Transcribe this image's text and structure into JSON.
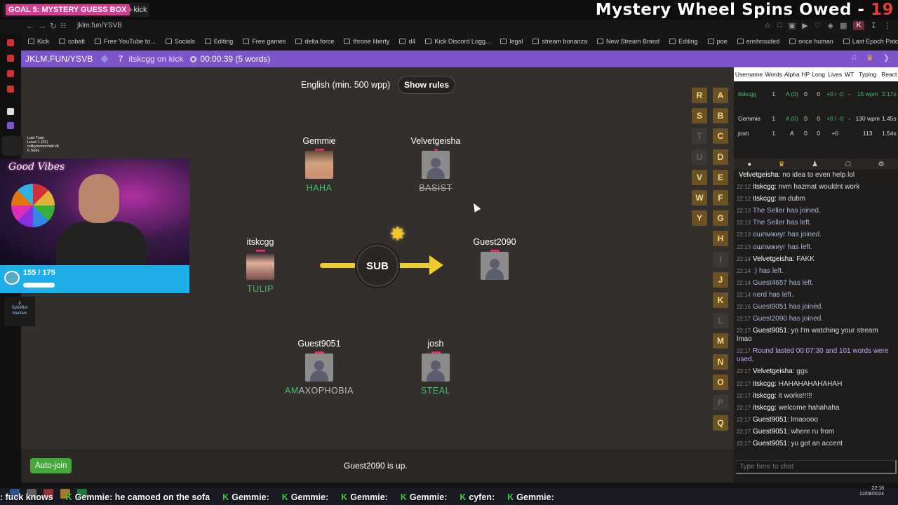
{
  "browser": {
    "tab_goal": "GOAL 5: MYSTERY GUESS BOX",
    "tab_kick": "kick",
    "url": "jklm.fun/YSVB",
    "overlay_title": "Mystery Wheel Spins Owed - ",
    "overlay_count": "19",
    "k_badge": "K"
  },
  "bookmarks": [
    "Kick",
    "cobalt",
    "Free YouTube to...",
    "Socials",
    "Editing",
    "Free games",
    "delta force",
    "throne liberty",
    "d4",
    "Kick Discord Logg...",
    "legal",
    "stream bonanza",
    "New Stream Brand",
    "Editing",
    "poe",
    "enshrouded",
    "once human",
    "Last Epoch Patch..."
  ],
  "header": {
    "room": "JKLM.FUN/YSVB",
    "player_count": "7",
    "host": "itskcgg on kick",
    "timer": "00:00:39 (5 words)"
  },
  "game": {
    "rules_text": "English (min. 500 wpp)",
    "show_rules": "Show rules",
    "prompt": "SUB",
    "status": "Guest2090 is up.",
    "auto_join": "Auto-join",
    "players": [
      {
        "name": "Gemmie",
        "hearts": "♥♥♥",
        "word": "HAHA",
        "style": "green"
      },
      {
        "name": "Velvetgeisha",
        "hearts": "♥",
        "word": "BASIST",
        "style": "strike"
      },
      {
        "name": "itskcgg",
        "hearts": "♥♥♥",
        "word": "TULIP",
        "style": "green"
      },
      {
        "name": "Guest2090",
        "hearts": "♥♥♥",
        "word": "",
        "style": "grey"
      },
      {
        "name": "Guest9051",
        "hearts": "♥♥♥",
        "word_hi": "AM",
        "word_rest": "AXOPHOBIA",
        "style": "mixed"
      },
      {
        "name": "josh",
        "hearts": "♥♥♥",
        "word": "STEAL",
        "style": "green"
      }
    ],
    "letters_left": [
      "R",
      "S",
      "T",
      "U",
      "V",
      "W",
      "Y"
    ],
    "letters_right": [
      "A",
      "B",
      "C",
      "D",
      "E",
      "F",
      "G",
      "H",
      "I",
      "J",
      "K",
      "L",
      "M",
      "N",
      "O",
      "P",
      "Q"
    ]
  },
  "scoreboard": {
    "headers": [
      "Username",
      "Words",
      "Alpha",
      "HP",
      "Long",
      "Lives",
      "WT",
      "Typing",
      "React"
    ],
    "rows": [
      {
        "user": "itskcgg",
        "words": "1",
        "alpha": "A (0)",
        "hp": "0",
        "long": "0",
        "lives": "+0 / -0",
        "wt": "-",
        "typing": "15 wpm",
        "react": "2.17s",
        "green": true
      },
      {
        "user": "Gemmie",
        "words": "1",
        "alpha": "A (0)",
        "hp": "0",
        "long": "0",
        "lives": "+0 / -0",
        "wt": "-",
        "typing": "130 wpm",
        "react": "1.45s",
        "green": false
      },
      {
        "user": "josh",
        "words": "1",
        "alpha": "A",
        "hp": "0",
        "long": "0",
        "lives": "+0",
        "wt": "",
        "typing": "113",
        "react": "1.54s",
        "green": false
      }
    ]
  },
  "chat": {
    "input_placeholder": "Type here to chat",
    "messages": [
      {
        "time": "",
        "user": "Velvetgeisha:",
        "text": " no idea to even help lol"
      },
      {
        "time": "22:12",
        "user": "itskcgg:",
        "text": " nvm hazmat wouldnt work"
      },
      {
        "time": "22:12",
        "user": "itskcgg:",
        "text": " im dubm"
      },
      {
        "time": "22:13",
        "sys": "The Seller has joined."
      },
      {
        "time": "22:13",
        "sys": "The Seller has left."
      },
      {
        "time": "22:13",
        "sys": "ошпмжиуг has joined."
      },
      {
        "time": "22:13",
        "sys": "ошпмжиуг has left."
      },
      {
        "time": "22:14",
        "user": "Velvetgeisha:",
        "text": " FAKK"
      },
      {
        "time": "22:14",
        "sys": ":) has left."
      },
      {
        "time": "22:14",
        "sys": "Guest4657 has left."
      },
      {
        "time": "22:14",
        "sys": "nerd has left."
      },
      {
        "time": "22:16",
        "sys": "Guest9051 has joined."
      },
      {
        "time": "22:17",
        "sys": "Guest2090 has joined."
      },
      {
        "time": "22:17",
        "user": "Guest9051:",
        "text": " yo I'm watching your stream lmao",
        "wrap": true
      },
      {
        "time": "22:17",
        "sysp": "Round lasted 00:07:30 and 101 words were used.",
        "wrap": true
      },
      {
        "time": "22:17",
        "user": "Velvetgeisha:",
        "text": " ggs"
      },
      {
        "time": "22:17",
        "user": "itskcgg:",
        "text": " HAHAHAHAHAHAH"
      },
      {
        "time": "22:17",
        "user": "itskcgg:",
        "text": " it works!!!!!"
      },
      {
        "time": "22:17",
        "user": "itskcgg:",
        "text": " welcome hahahaha"
      },
      {
        "time": "22:17",
        "user": "Guest9051:",
        "text": " lmaoooo"
      },
      {
        "time": "22:17",
        "user": "Guest9051:",
        "text": " where ru from"
      },
      {
        "time": "22:17",
        "user": "Guest9051:",
        "text": " yu got an accent"
      }
    ]
  },
  "stream_overlay": {
    "last_train": "Last Train",
    "level": "Level 1 (31)",
    "viewer": "milkymoonchild x5",
    "subs": "6 Subs",
    "good_vibes": "Good Vibes",
    "sub_goal": "155 / 175",
    "spotibot": "SpotiBot Inactive"
  },
  "ticker": [
    {
      "user": "",
      "text": ": fuck knows"
    },
    {
      "user": "Gemmie",
      "text": ": he camoed on the sofa"
    },
    {
      "user": "Gemmie",
      "text": ":"
    },
    {
      "user": "Gemmie",
      "text": ":"
    },
    {
      "user": "Gemmie",
      "text": ":"
    },
    {
      "user": "Gemmie",
      "text": ":"
    },
    {
      "user": "cyfen",
      "text": ":"
    },
    {
      "user": "Gemmie",
      "text": ":"
    }
  ],
  "clock": {
    "time": "22:18",
    "date": "12/08/2024"
  }
}
